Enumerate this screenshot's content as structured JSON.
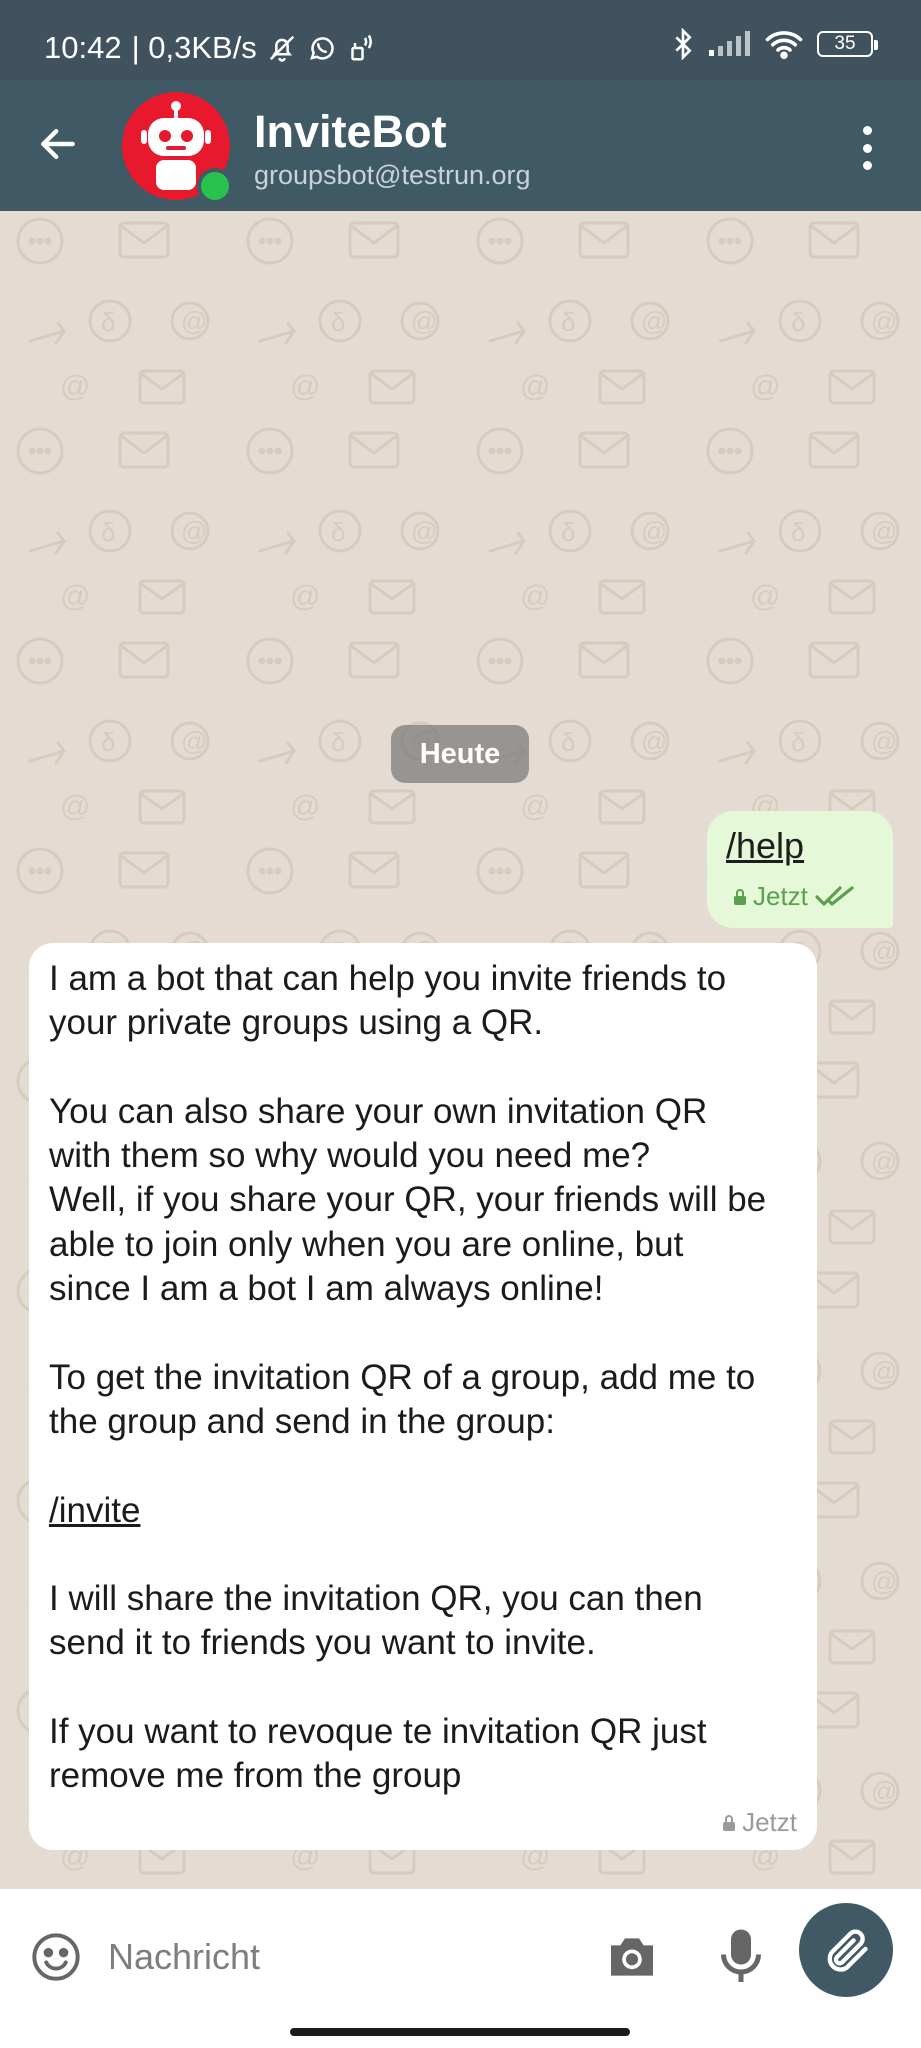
{
  "status_bar": {
    "time": "10:42",
    "data_rate": "| 0,3KB/s",
    "battery_level": "35",
    "icons": [
      "bell-off-icon",
      "whatsapp-icon",
      "nfc-icon",
      "bluetooth-icon",
      "signal-icon",
      "wifi-icon",
      "battery-icon"
    ]
  },
  "header": {
    "title": "InviteBot",
    "subtitle": "groupsbot@testrun.org",
    "back_icon": "arrow-left-icon",
    "menu_icon": "more-vertical-icon",
    "avatar_color": "#e8192c",
    "online_color": "#28c24f"
  },
  "chat": {
    "day_label": "Heute",
    "messages": [
      {
        "direction": "outgoing",
        "text": "/help",
        "time": "Jetzt",
        "status_icon": "double-check-icon",
        "bubble_color": "#e5f8d7"
      },
      {
        "direction": "incoming",
        "paragraphs": [
          "I am a bot that can help you invite friends to\nyour private groups using a QR.",
          "You can also share your own invitation QR\nwith them so why would you need me?\nWell, if you share your QR, your friends will be\nable to join only when you are online, but\nsince I am a bot I am always online!",
          "To get the invitation QR of a group, add me to\nthe group and send in the group:"
        ],
        "command": "/invite",
        "paragraphs_after": [
          "I will share the invitation QR, you can then\nsend it to friends you want to invite.",
          "If you want to revoque te invitation QR just\nremove me from the group"
        ],
        "time": "Jetzt"
      }
    ]
  },
  "composer": {
    "placeholder": "Nachricht",
    "emoji_icon": "emoji-icon",
    "camera_icon": "camera-icon",
    "mic_icon": "microphone-icon",
    "attach_icon": "paperclip-icon",
    "accent_color": "#3f5a64"
  }
}
